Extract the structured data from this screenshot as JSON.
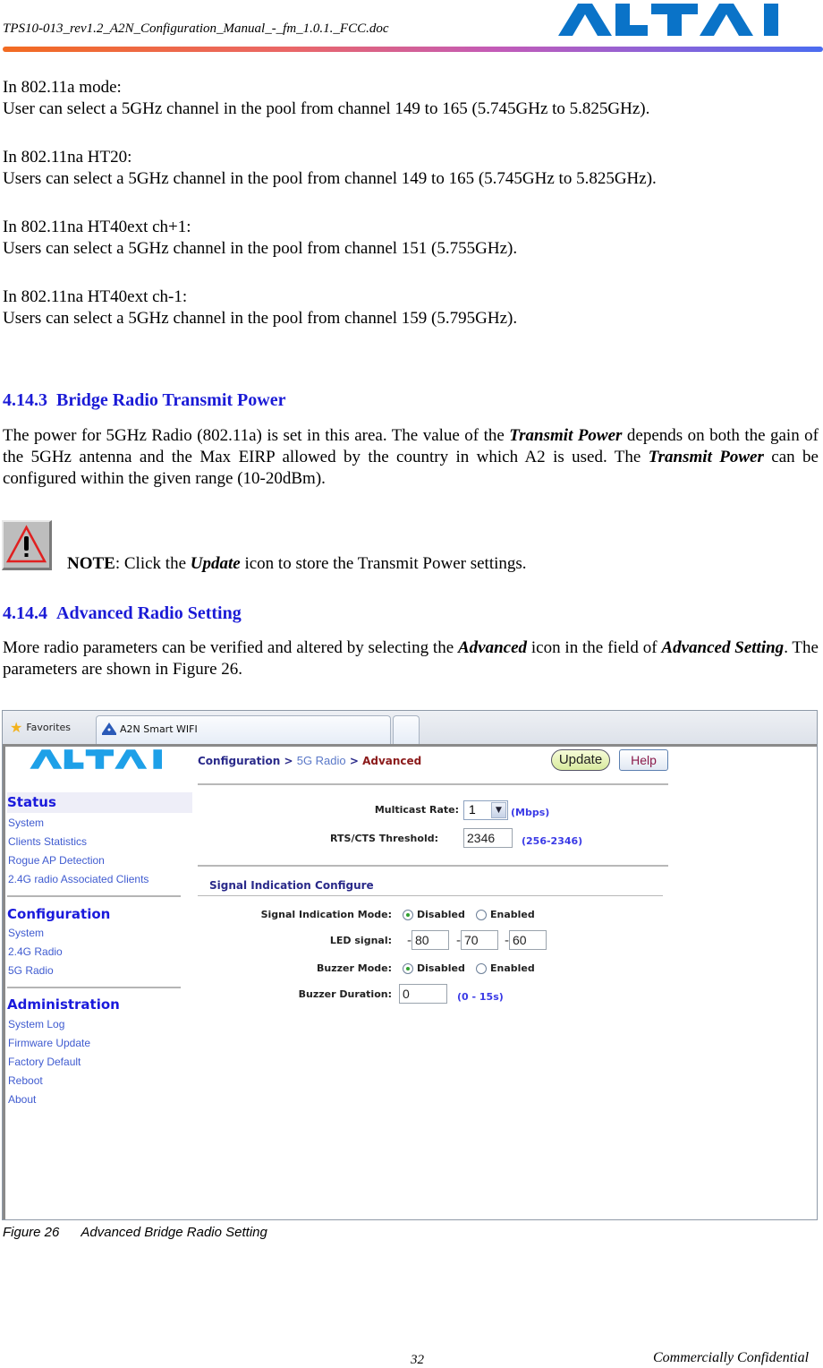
{
  "header": {
    "doc_title": "TPS10-013_rev1.2_A2N_Configuration_Manual_-_fm_1.0.1._FCC.doc",
    "logo_text": "ALTAI"
  },
  "modes": [
    {
      "title": "In 802.11a mode:",
      "text": "User can select a 5GHz channel in the pool from channel 149 to 165 (5.745GHz to 5.825GHz)."
    },
    {
      "title": "In 802.11na HT20:",
      "text": "Users can select a 5GHz channel in the pool from channel 149 to 165 (5.745GHz to 5.825GHz)."
    },
    {
      "title": "In 802.11na HT40ext ch+1:",
      "text": "Users can select a 5GHz channel in the pool from channel 151 (5.755GHz)."
    },
    {
      "title": "In 802.11na HT40ext ch-1:",
      "text": "Users can select a 5GHz channel in the pool from channel 159 (5.795GHz)."
    }
  ],
  "section_4143": {
    "number": "4.14.3",
    "title": "Bridge Radio Transmit Power",
    "p1": "The power for 5GHz Radio (802.11a) is set in this area. The value of the ",
    "p1_em": "Transmit Power",
    "p2": " depends on both the gain of the 5GHz antenna and the Max EIRP allowed by the country in which A2 is used. The ",
    "p2_em": "Transmit Power",
    "p3": " can be configured within the given range (10-20dBm)."
  },
  "note": {
    "label": "NOTE",
    "t1": ": Click the ",
    "em": "Update",
    "t2": " icon to store the Transmit Power settings."
  },
  "section_4144": {
    "number": "4.14.4",
    "title": "Advanced Radio Setting",
    "p1": "More radio parameters can be verified and altered by selecting the ",
    "p1_em": "Advanced",
    "p2": " icon in the field of ",
    "p2_em": "Advanced Setting",
    "p3": ". The parameters are shown in Figure 26."
  },
  "browser": {
    "favorites_label": "Favorites",
    "tab_title": "A2N Smart WIFI",
    "logo_text": "ALTAI",
    "breadcrumb": {
      "part1": "Configuration",
      "sep": ">",
      "part2": "5G Radio",
      "part3": "Advanced"
    },
    "update_label": "Update",
    "help_label": "Help",
    "sidebar": {
      "status": {
        "heading": "Status",
        "items": [
          "System",
          "Clients Statistics",
          "Rogue AP Detection",
          "2.4G radio Associated Clients"
        ]
      },
      "configuration": {
        "heading": "Configuration",
        "items": [
          "System",
          "2.4G Radio",
          "5G Radio"
        ]
      },
      "administration": {
        "heading": "Administration",
        "items": [
          "System Log",
          "Firmware Update",
          "Factory Default",
          "Reboot",
          "About"
        ]
      }
    },
    "form": {
      "multicast_label": "Multicast Rate:",
      "multicast_value": "1",
      "multicast_unit": "(Mbps)",
      "rts_label": "RTS/CTS Threshold:",
      "rts_value": "2346",
      "rts_range": "(256-2346)",
      "signal_section_title": "Signal Indication Configure",
      "signal_mode_label": "Signal Indication Mode:",
      "disabled_label": "Disabled",
      "enabled_label": "Enabled",
      "signal_mode_selected": "Disabled",
      "led_label": "LED signal:",
      "led_prefix": "-",
      "led_values": [
        "80",
        "70",
        "60"
      ],
      "buzzer_mode_label": "Buzzer Mode:",
      "buzzer_mode_selected": "Disabled",
      "buzzer_duration_label": "Buzzer Duration:",
      "buzzer_duration_value": "0",
      "buzzer_duration_range": "(0 - 15s)"
    }
  },
  "caption": {
    "figure": "Figure 26",
    "text": "Advanced Bridge Radio Setting"
  },
  "footer": {
    "page_number": "32",
    "confidential": "Commercially Confidential"
  },
  "colors": {
    "heading_blue": "#1a1ad6",
    "altai_blue": "#0a73c8",
    "breadcrumb_red": "#8b1a1a"
  }
}
